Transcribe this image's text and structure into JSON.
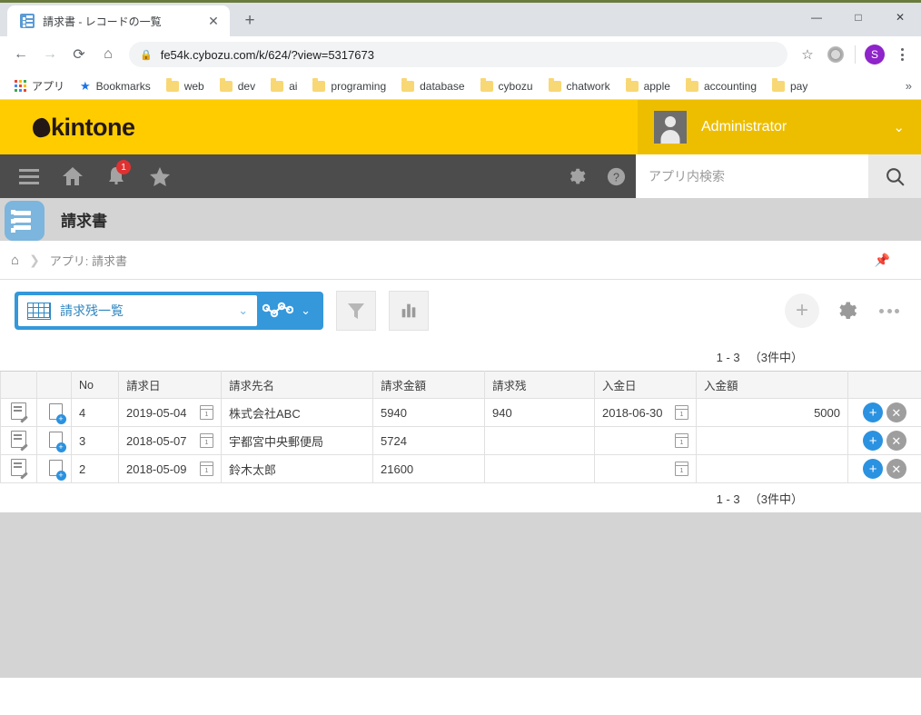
{
  "browser": {
    "tab": {
      "title": "請求書 - レコードの一覧",
      "close_label": "✕"
    },
    "newtab_label": "+",
    "window": {
      "minimize": "—",
      "maximize": "□",
      "close": "✕"
    },
    "nav": {
      "back": "←",
      "forward": "→",
      "reload": "⟳",
      "home": "⌂"
    },
    "omnibox": {
      "lock": "🔒",
      "url": "fe54k.cybozu.com/k/624/?view=5317673",
      "star": "☆"
    },
    "profile_initial": "S",
    "bookmarks": {
      "apps_label": "アプリ",
      "items": [
        {
          "label": "Bookmarks",
          "icon": "star-icon"
        },
        {
          "label": "web",
          "icon": "folder-icon"
        },
        {
          "label": "dev",
          "icon": "folder-icon"
        },
        {
          "label": "ai",
          "icon": "folder-icon"
        },
        {
          "label": "programing",
          "icon": "folder-icon"
        },
        {
          "label": "database",
          "icon": "folder-icon"
        },
        {
          "label": "cybozu",
          "icon": "folder-icon"
        },
        {
          "label": "chatwork",
          "icon": "folder-icon"
        },
        {
          "label": "apple",
          "icon": "folder-icon"
        },
        {
          "label": "accounting",
          "icon": "folder-icon"
        },
        {
          "label": "pay",
          "icon": "folder-icon"
        }
      ],
      "overflow": "»"
    }
  },
  "kintone": {
    "brand": "kintone",
    "user": {
      "name": "Administrator",
      "caret": "⌄"
    },
    "nav": {
      "notification_badge": "1",
      "search_placeholder": "アプリ内検索"
    },
    "app": {
      "title": "請求書",
      "breadcrumb": "アプリ: 請求書"
    },
    "toolbar": {
      "view_name": "請求残一覧",
      "view_caret": "⌄",
      "graph_caret": "⌄"
    },
    "pagination": {
      "top": "1 - 3 　（3件中）",
      "bottom": "1 - 3 　（3件中）"
    }
  },
  "table": {
    "columns": [
      "",
      "",
      "No",
      "請求日",
      "請求先名",
      "請求金額",
      "請求残",
      "入金日",
      "入金額",
      ""
    ],
    "rows": [
      {
        "no": "4",
        "invoice_date": "2019-05-04",
        "customer": "株式会社ABC",
        "invoice_amount": "5940",
        "balance": "940",
        "payment_date": "2018-06-30",
        "payment_amount": "5000"
      },
      {
        "no": "3",
        "invoice_date": "2018-05-07",
        "customer": "宇都宮中央郵便局",
        "invoice_amount": "5724",
        "balance": "",
        "payment_date": "",
        "payment_amount": ""
      },
      {
        "no": "2",
        "invoice_date": "2018-05-09",
        "customer": "鈴木太郎",
        "invoice_amount": "21600",
        "balance": "",
        "payment_date": "",
        "payment_amount": ""
      }
    ]
  },
  "colors": {
    "kintone_yellow": "#ffcc00",
    "kintone_yellow_dark": "#edbe00",
    "nav_gray": "#4c4c4c",
    "accent_blue": "#3498db",
    "app_icon_blue": "#7cb5dd"
  }
}
